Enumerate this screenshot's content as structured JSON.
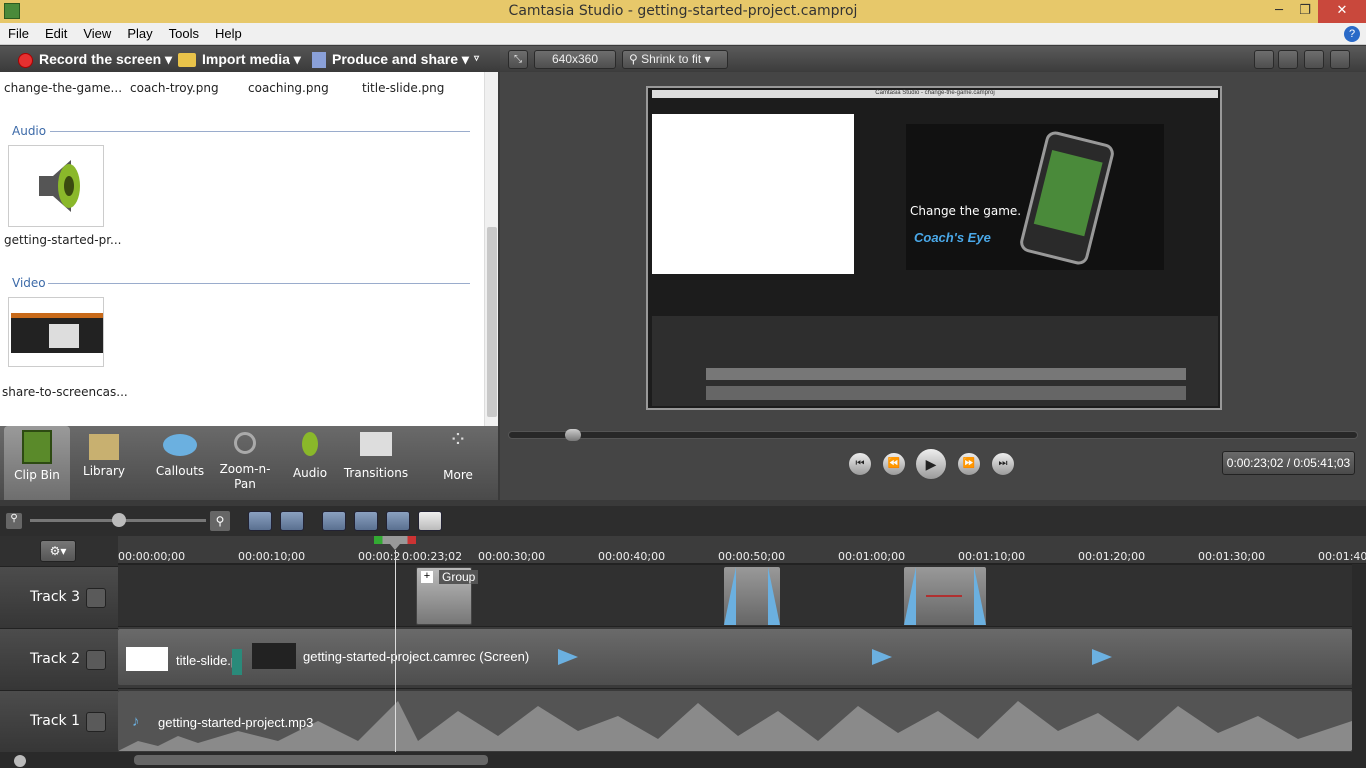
{
  "window": {
    "title": "Camtasia Studio - getting-started-project.camproj",
    "minimize": "─",
    "restore": "❐",
    "close": "✕"
  },
  "menu": [
    "File",
    "Edit",
    "View",
    "Play",
    "Tools",
    "Help"
  ],
  "toolbar": {
    "record": "Record the screen",
    "import": "Import media",
    "produce": "Produce and share"
  },
  "clipbin": {
    "top_files": [
      "change-the-game...",
      "coach-troy.png",
      "coaching.png",
      "title-slide.png"
    ],
    "audio_title": "Audio",
    "audio_file": "getting-started-pr...",
    "video_title": "Video",
    "video_file": "share-to-screencas..."
  },
  "tabs": [
    {
      "label": "Clip Bin"
    },
    {
      "label": "Library"
    },
    {
      "label": "Callouts"
    },
    {
      "label": "Zoom-n-Pan"
    },
    {
      "label": "Audio"
    },
    {
      "label": "Transitions"
    },
    {
      "label": "More"
    }
  ],
  "preview": {
    "dimensions": "640x360",
    "fit": "Shrink to fit",
    "time": "0:00:23;02 / 0:05:41;03",
    "inner": {
      "title": "Camtasia Studio - change-the-game.camproj",
      "headline": "Change the game.",
      "brand": "Coach's Eye"
    }
  },
  "timeline": {
    "playhead": "0:00:23;02",
    "ruler": [
      "00:00:00;00",
      "00:00:10;00",
      "00:00:20",
      "00:00:30;00",
      "00:00:40;00",
      "00:00:50;00",
      "00:01:00;00",
      "00:01:10;00",
      "00:01:20;00",
      "00:01:30;00",
      "00:01:40;00"
    ],
    "tracks": [
      {
        "name": "Track 3"
      },
      {
        "name": "Track 2"
      },
      {
        "name": "Track 1"
      }
    ],
    "group_label": "Group",
    "track2_title": "title-slide.p",
    "track2_screen": "getting-started-project.camrec (Screen)",
    "track1_audio": "getting-started-project.mp3"
  },
  "colors": {
    "titlebar": "#e7c86a",
    "accent_blue": "#6bb0e0",
    "record_red": "#e53030"
  }
}
